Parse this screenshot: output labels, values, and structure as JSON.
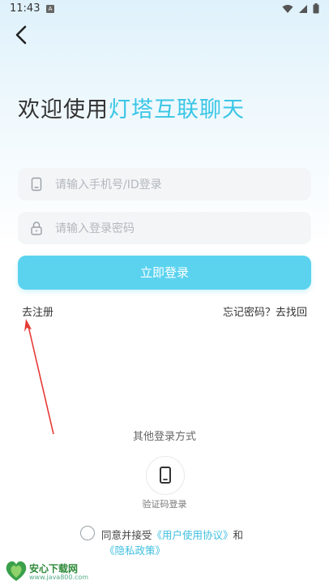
{
  "status_bar": {
    "time": "11:43"
  },
  "header": {
    "back_icon": "chevron-left-icon"
  },
  "welcome": {
    "prefix": "欢迎使用",
    "brand": "灯塔互联聊天"
  },
  "form": {
    "phone_placeholder": "请输入手机号/ID登录",
    "password_placeholder": "请输入登录密码",
    "login_label": "立即登录",
    "register_link": "去注册",
    "forgot_link": "忘记密码？去找回"
  },
  "other_login": {
    "title": "其他登录方式",
    "sms_label": "验证码登录",
    "sms_icon": "phone-icon"
  },
  "agreement": {
    "prefix": "同意并接受",
    "user_agreement": "《用户使用协议》",
    "and": "和",
    "privacy_policy": "《隐私政策》"
  },
  "watermark": {
    "name": "安心下载网",
    "url": "www.java800.com"
  },
  "colors": {
    "accent": "#5bd3ef",
    "brand_text": "#39c6e6",
    "annotation_arrow": "#e53935"
  }
}
